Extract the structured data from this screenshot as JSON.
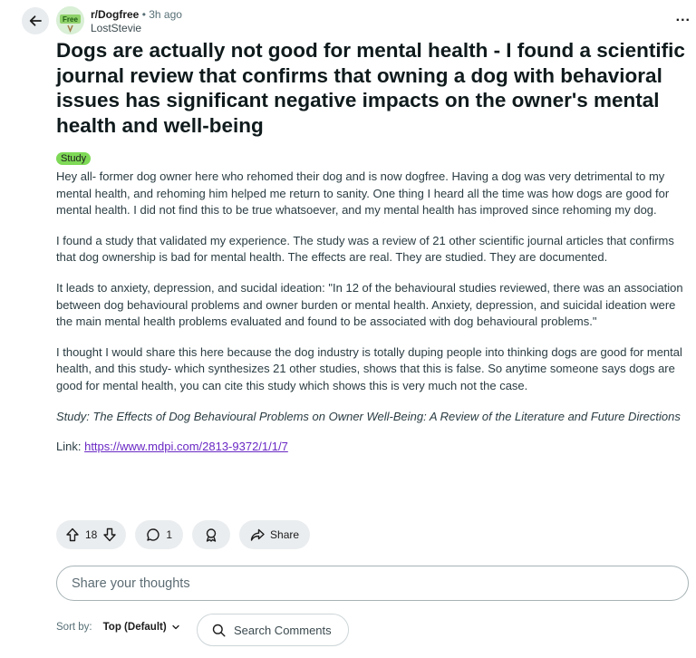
{
  "header": {
    "subreddit": "r/Dogfree",
    "separator": "•",
    "age": "3h ago",
    "username": "LostStevie",
    "avatar_text": "Free",
    "more": "..."
  },
  "post": {
    "title": "Dogs are actually not good for mental health - I found a scientific journal review that confirms that owning a dog with behavioral issues has significant negative impacts on the owner's mental health and well-being",
    "flair": "Study",
    "paragraphs": [
      "Hey all- former dog owner here who rehomed their dog and is now dogfree. Having a dog was very detrimental to my mental health, and rehoming him helped me return to sanity. One thing I heard all the time was how dogs are good for mental health. I did not find this to be true whatsoever, and my mental health has improved since rehoming my dog.",
      "I found a study that validated my experience. The study was a review of 21 other scientific journal articles that confirms that dog ownership is bad for mental health. The effects are real. They are studied. They are documented.",
      "It leads to anxiety, depression, and sucidal ideation: \"In 12 of the behavioural studies reviewed, there was an association between dog behavioural problems and owner burden or mental health. Anxiety, depression, and suicidal ideation were the main mental health problems evaluated and found to be associated with dog behavioural problems.\"",
      "I thought I would share this here because the dog industry is totally duping people into thinking dogs are good for mental health, and this study- which synthesizes 21 other studies, shows that this is false. So anytime someone says dogs are good for mental health, you can cite this study which shows this is very much not the case."
    ],
    "citation": "Study: The Effects of Dog Behavioural Problems on Owner Well-Being: A Review of the Literature and Future Directions",
    "link_label": "Link:",
    "link_url": "https://www.mdpi.com/2813-9372/1/1/7"
  },
  "actions": {
    "votes": "18",
    "comments": "1",
    "share": "Share"
  },
  "comment_input": {
    "placeholder": "Share your thoughts"
  },
  "sort": {
    "label": "Sort by:",
    "value": "Top (Default)"
  },
  "search_comments": {
    "label": "Search Comments"
  },
  "colors": {
    "flair": "#7ed957",
    "link": "#6a29c4",
    "pill": "#eaedef"
  }
}
